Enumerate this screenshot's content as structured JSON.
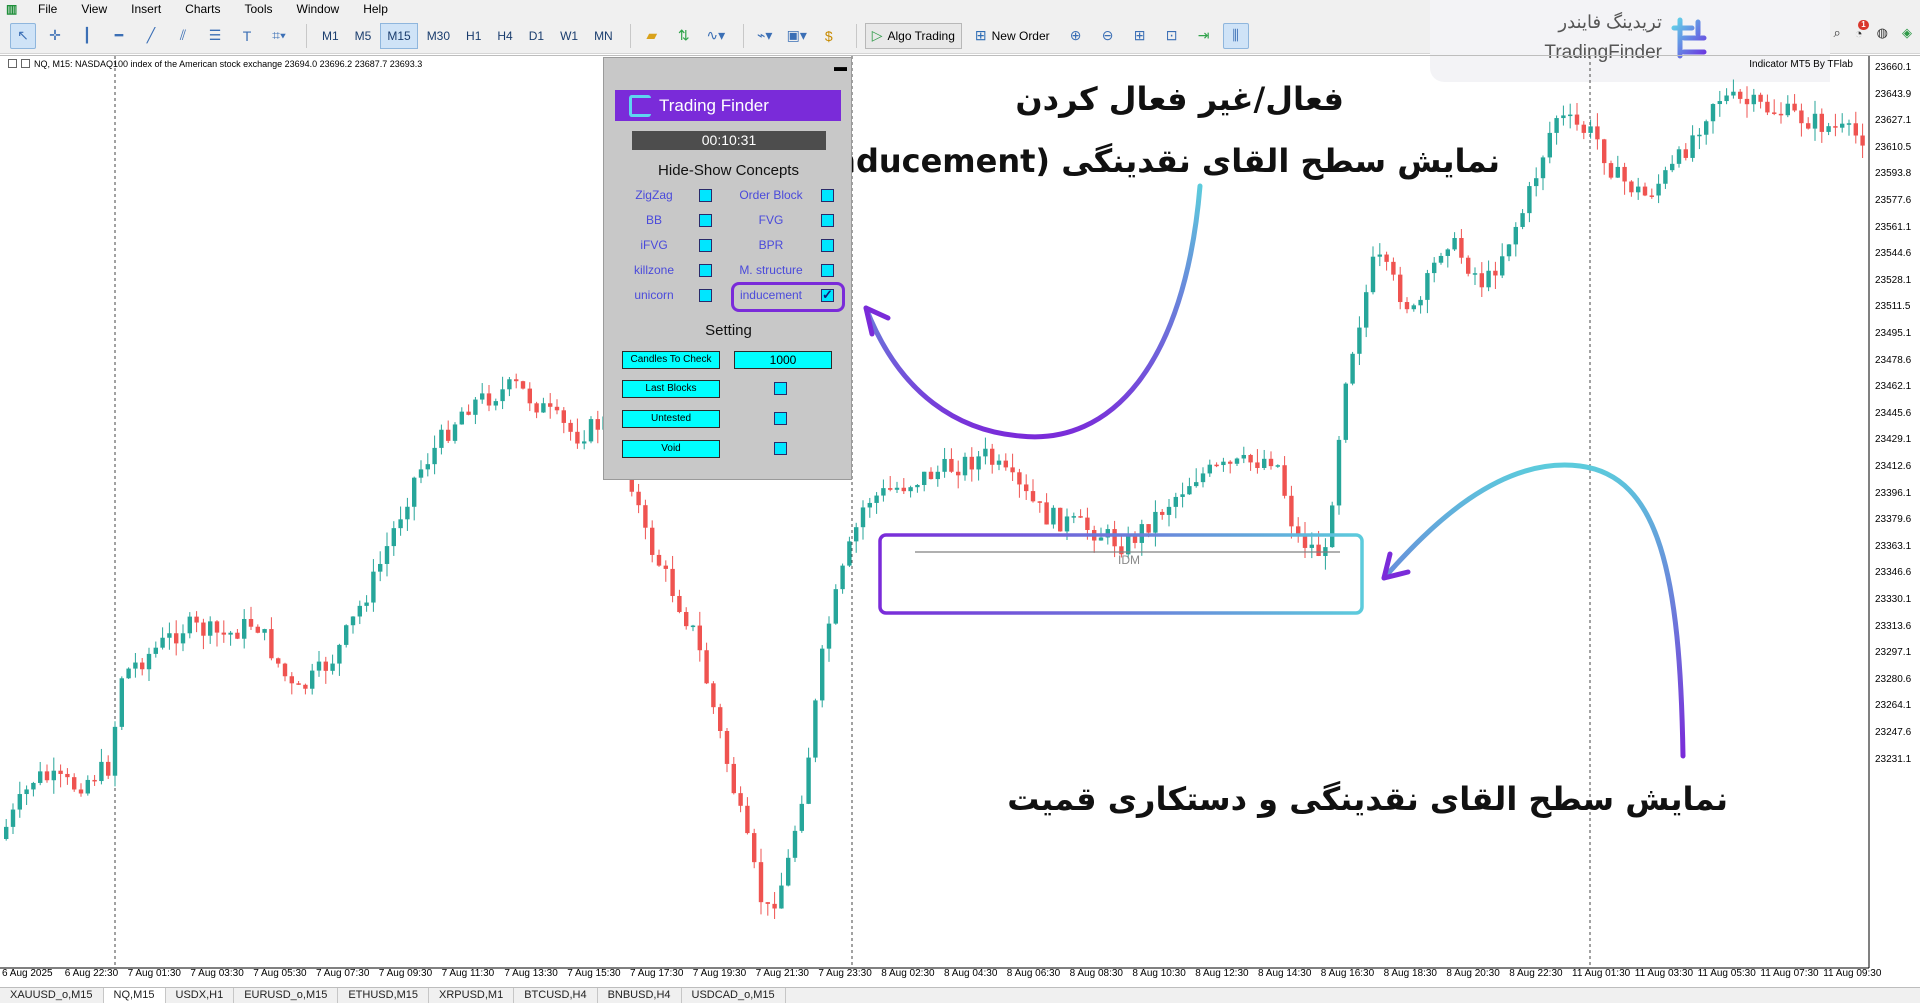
{
  "menubar": {
    "items": [
      "File",
      "View",
      "Insert",
      "Charts",
      "Tools",
      "Window",
      "Help"
    ]
  },
  "toolbar": {
    "timeframes": [
      "M1",
      "M5",
      "M15",
      "M30",
      "H1",
      "H4",
      "D1",
      "W1",
      "MN"
    ],
    "active_timeframe": "M15",
    "algo_trading_label": "Algo Trading",
    "new_order_label": "New Order"
  },
  "watermark": {
    "text_fa": "تریدینگ فایندر",
    "text_en": "TradingFinder"
  },
  "chart": {
    "info": "NQ, M15:  NASDAQ100 index of the American stock exchange  23694.0 23696.2 23687.7 23693.3",
    "indicator_title": "Indicator MT5 By TFlab",
    "idm_label": "IDM",
    "y_ticks": [
      "23660.1",
      "23643.9",
      "23627.1",
      "23610.5",
      "23593.8",
      "23577.6",
      "23561.1",
      "23544.6",
      "23528.1",
      "23511.5",
      "23495.1",
      "23478.6",
      "23462.1",
      "23445.6",
      "23429.1",
      "23412.6",
      "23396.1",
      "23379.6",
      "23363.1",
      "23346.6",
      "23330.1",
      "23313.6",
      "23297.1",
      "23280.6",
      "23264.1",
      "23247.6",
      "23231.1"
    ],
    "x_ticks": [
      "6 Aug 2025",
      "6 Aug 22:30",
      "7 Aug 01:30",
      "7 Aug 03:30",
      "7 Aug 05:30",
      "7 Aug 07:30",
      "7 Aug 09:30",
      "7 Aug 11:30",
      "7 Aug 13:30",
      "7 Aug 15:30",
      "7 Aug 17:30",
      "7 Aug 19:30",
      "7 Aug 21:30",
      "7 Aug 23:30",
      "8 Aug 02:30",
      "8 Aug 04:30",
      "8 Aug 06:30",
      "8 Aug 08:30",
      "8 Aug 10:30",
      "8 Aug 12:30",
      "8 Aug 14:30",
      "8 Aug 16:30",
      "8 Aug 18:30",
      "8 Aug 20:30",
      "8 Aug 22:30",
      "11 Aug 01:30",
      "11 Aug 03:30",
      "11 Aug 05:30",
      "11 Aug 07:30",
      "11 Aug 09:30"
    ],
    "colors": {
      "bull": "#26a69a",
      "bear": "#ef5350",
      "highlight_purple": "#7a2bd9",
      "highlight_cyan": "#5ccbdc"
    }
  },
  "panel": {
    "logo_text": "Trading Finder",
    "timer": "00:10:31",
    "concepts_title": "Hide-Show Concepts",
    "concepts": [
      {
        "label": "ZigZag",
        "checked": false
      },
      {
        "label": "Order Block",
        "checked": false
      },
      {
        "label": "BB",
        "checked": false
      },
      {
        "label": "FVG",
        "checked": false
      },
      {
        "label": "iFVG",
        "checked": false
      },
      {
        "label": "BPR",
        "checked": false
      },
      {
        "label": "killzone",
        "checked": false
      },
      {
        "label": "M. structure",
        "checked": false
      },
      {
        "label": "unicorn",
        "checked": false
      },
      {
        "label": "inducement",
        "checked": true
      }
    ],
    "setting_title": "Setting",
    "candles_to_check_label": "Candles To Check",
    "candles_to_check_value": "1000",
    "last_blocks_label": "Last Blocks",
    "untested_label": "Untested",
    "void_label": "Void"
  },
  "annotations": {
    "toggle_line1": "فعال/غیر فعال کردن",
    "toggle_line2": "نمایش سطح القای نقدینگی (Inducement)",
    "bottom": "نمایش سطح القای نقدینگی و دستکاری قمیت"
  },
  "tabs": {
    "items": [
      "XAUUSD_o,M15",
      "NQ,M15",
      "USDX,H1",
      "EURUSD_o,M15",
      "ETHUSD,M15",
      "XRPUSD,M1",
      "BTCUSD,H4",
      "BNBUSD,H4",
      "USDCAD_o,M15"
    ],
    "active": "NQ,M15"
  }
}
